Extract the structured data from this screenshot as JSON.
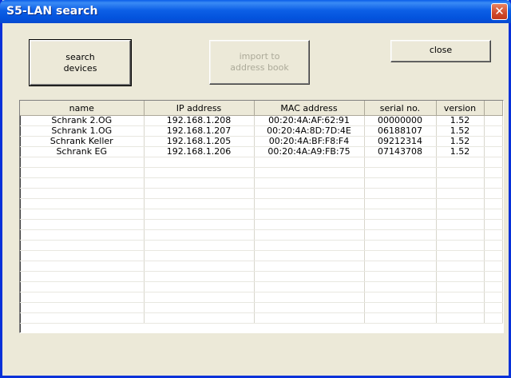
{
  "window": {
    "title": "S5-LAN search",
    "close_glyph": "✕"
  },
  "buttons": {
    "search_label": "search\ndevices",
    "import_label": "import to\naddress book",
    "close_label": "close"
  },
  "table": {
    "columns": [
      "name",
      "IP address",
      "MAC address",
      "serial no.",
      "version"
    ],
    "rows": [
      [
        "Schrank 2.OG",
        "192.168.1.208",
        "00:20:4A:AF:62:91",
        "00000000",
        "1.52"
      ],
      [
        "Schrank 1.OG",
        "192.168.1.207",
        "00:20:4A:8D:7D:4E",
        "06188107",
        "1.52"
      ],
      [
        "Schrank Keller",
        "192.168.1.205",
        "00:20:4A:BF:F8:F4",
        "09212314",
        "1.52"
      ],
      [
        "Schrank EG",
        "192.168.1.206",
        "00:20:4A:A9:FB:75",
        "07143708",
        "1.52"
      ],
      [
        "",
        "",
        "",
        "",
        ""
      ],
      [
        "",
        "",
        "",
        "",
        ""
      ],
      [
        "",
        "",
        "",
        "",
        ""
      ],
      [
        "",
        "",
        "",
        "",
        ""
      ],
      [
        "",
        "",
        "",
        "",
        ""
      ],
      [
        "",
        "",
        "",
        "",
        ""
      ],
      [
        "",
        "",
        "",
        "",
        ""
      ],
      [
        "",
        "",
        "",
        "",
        ""
      ],
      [
        "",
        "",
        "",
        "",
        ""
      ],
      [
        "",
        "",
        "",
        "",
        ""
      ],
      [
        "",
        "",
        "",
        "",
        ""
      ],
      [
        "",
        "",
        "",
        "",
        ""
      ],
      [
        "",
        "",
        "",
        "",
        ""
      ],
      [
        "",
        "",
        "",
        "",
        ""
      ],
      [
        "",
        "",
        "",
        "",
        ""
      ],
      [
        "",
        "",
        "",
        "",
        ""
      ]
    ]
  }
}
